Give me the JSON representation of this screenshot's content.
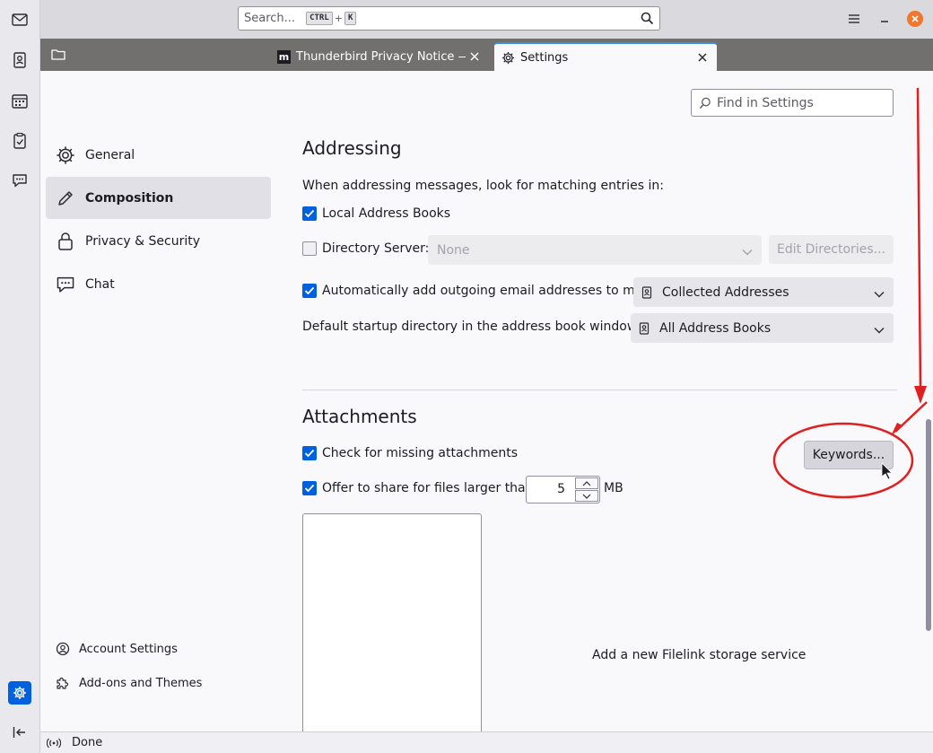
{
  "titlebar": {
    "search_placeholder": "Search...",
    "search_key1": "CTRL",
    "search_plus": "+",
    "search_key2": "K"
  },
  "tabs": [
    {
      "label": "Thunderbird Privacy Notice — M",
      "favicon": "m"
    },
    {
      "label": "Settings"
    }
  ],
  "sidebar": {
    "categories": [
      {
        "label": "General",
        "icon": "gear-icon"
      },
      {
        "label": "Composition",
        "icon": "pencil-icon",
        "selected": true
      },
      {
        "label": "Privacy & Security",
        "icon": "lock-icon"
      },
      {
        "label": "Chat",
        "icon": "chat-icon"
      }
    ],
    "footer": [
      {
        "label": "Account Settings",
        "icon": "account-icon"
      },
      {
        "label": "Add-ons and Themes",
        "icon": "puzzle-icon"
      }
    ]
  },
  "find": {
    "placeholder": "Find in Settings"
  },
  "addressing": {
    "heading": "Addressing",
    "intro": "When addressing messages, look for matching entries in:",
    "local_address_books": {
      "label": "Local Address Books",
      "checked": true
    },
    "directory_server": {
      "label": "Directory Server:",
      "checked": false,
      "value": "None",
      "edit_button": "Edit Directories..."
    },
    "auto_add": {
      "label": "Automatically add outgoing email addresses to my:",
      "checked": true,
      "value": "Collected Addresses"
    },
    "startup_dir": {
      "label": "Default startup directory in the address book window:",
      "value": "All Address Books"
    }
  },
  "attachments": {
    "heading": "Attachments",
    "missing": {
      "label": "Check for missing attachments",
      "checked": true,
      "button": "Keywords..."
    },
    "share": {
      "label": "Offer to share for files larger than",
      "checked": true,
      "value": "5",
      "unit": "MB"
    },
    "filelink_message": "Add a new Filelink storage service"
  },
  "status": {
    "text": "Done"
  },
  "colors": {
    "accent": "#0061e0",
    "annotation": "#e02020",
    "close": "#f0772e"
  }
}
